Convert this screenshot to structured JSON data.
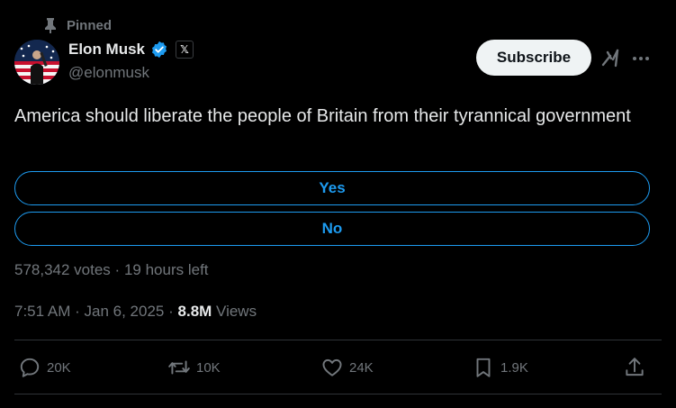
{
  "pinned_label": "Pinned",
  "author": {
    "display_name": "Elon Musk",
    "handle": "@elonmusk",
    "affiliate_badge": "𝕏"
  },
  "subscribe_label": "Subscribe",
  "tweet_text": "America should liberate the people of Britain from their tyrannical government",
  "poll": {
    "options": [
      "Yes",
      "No"
    ],
    "votes": "578,342 votes",
    "separator": "·",
    "time_left": "19 hours left"
  },
  "meta": {
    "time": "7:51 AM",
    "separator": "·",
    "date": "Jan 6, 2025",
    "views_count": "8.8M",
    "views_label": "Views"
  },
  "actions": {
    "replies": "20K",
    "reposts": "10K",
    "likes": "24K",
    "bookmarks": "1.9K"
  },
  "colors": {
    "background": "#000000",
    "text": "#e7e9ea",
    "muted": "#71767b",
    "accent": "#1d9bf0",
    "divider": "#2f3336"
  },
  "icons": [
    "pin-icon",
    "verified-icon",
    "grok-icon",
    "more-icon",
    "reply-icon",
    "repost-icon",
    "like-icon",
    "bookmark-icon",
    "share-icon"
  ]
}
